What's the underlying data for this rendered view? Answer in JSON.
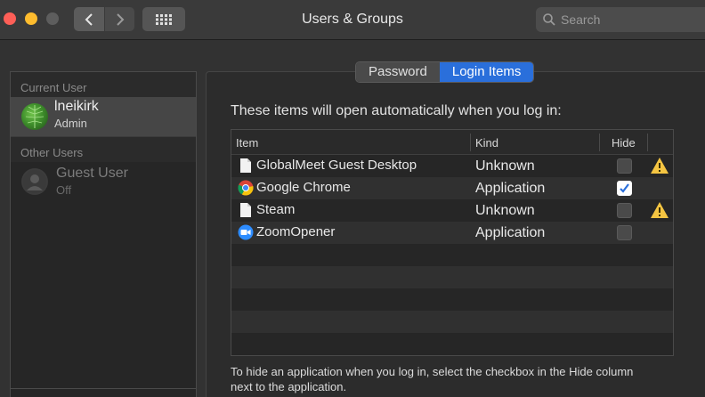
{
  "window": {
    "title": "Users & Groups",
    "search_placeholder": "Search"
  },
  "sidebar": {
    "current_user_label": "Current User",
    "current_user": {
      "name": "lneikirk",
      "role": "Admin"
    },
    "other_users_label": "Other Users",
    "other_users": [
      {
        "name": "Guest User",
        "status": "Off"
      }
    ]
  },
  "tabs": [
    {
      "label": "Password",
      "active": false
    },
    {
      "label": "Login Items",
      "active": true
    }
  ],
  "login_items": {
    "intro": "These items will open automatically when you log in:",
    "columns": {
      "item": "Item",
      "kind": "Kind",
      "hide": "Hide"
    },
    "rows": [
      {
        "item": "GlobalMeet Guest Desktop",
        "kind": "Unknown",
        "hide": false,
        "warning": true,
        "icon": "document-icon"
      },
      {
        "item": "Google Chrome",
        "kind": "Application",
        "hide": true,
        "warning": false,
        "icon": "chrome-icon"
      },
      {
        "item": "Steam",
        "kind": "Unknown",
        "hide": false,
        "warning": true,
        "icon": "document-icon"
      },
      {
        "item": "ZoomOpener",
        "kind": "Application",
        "hide": false,
        "warning": false,
        "icon": "zoom-icon"
      }
    ],
    "footer": "To hide an application when you log in, select the checkbox in the Hide column next to the application."
  },
  "colors": {
    "accent": "#2a6fdb",
    "warning": "#f5c542",
    "close": "#fe5f57",
    "minimize": "#febc2e"
  }
}
